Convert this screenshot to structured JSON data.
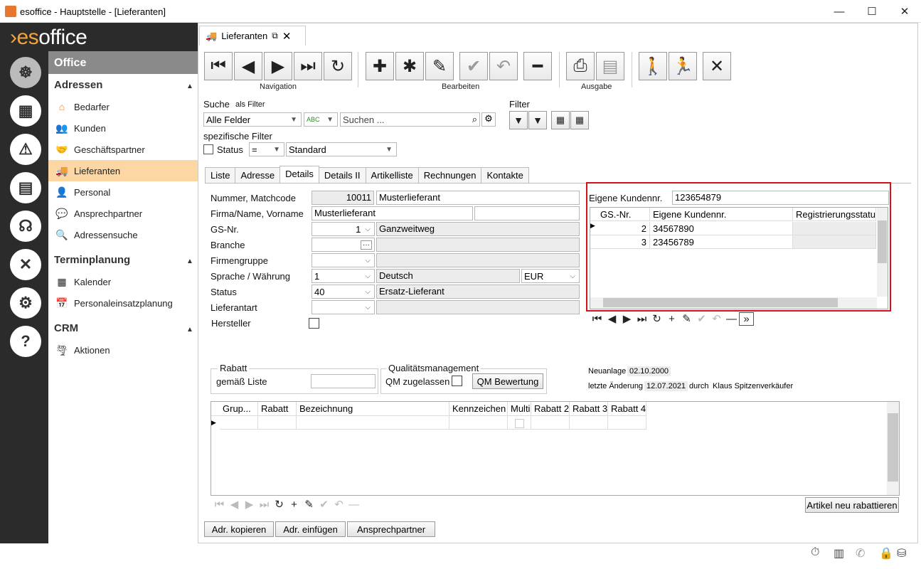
{
  "window": {
    "title": "esoffice - Hauptstelle - [Lieferanten]",
    "minimize": "—",
    "maximize": "☐",
    "close": "✕"
  },
  "logo": {
    "prefix": "›",
    "brand": "es",
    "rest": "office"
  },
  "sidebar": {
    "header": "Office",
    "sections": [
      {
        "title": "Adressen",
        "items": [
          "Bedarfer",
          "Kunden",
          "Geschäftspartner",
          "Lieferanten",
          "Personal",
          "Ansprechpartner",
          "Adressensuche"
        ]
      },
      {
        "title": "Terminplanung",
        "items": [
          "Kalender",
          "Personaleinsatzplanung"
        ]
      },
      {
        "title": "CRM",
        "items": [
          "Aktionen"
        ]
      }
    ],
    "selected": "Lieferanten"
  },
  "doc_tab": {
    "label": "Lieferanten"
  },
  "toolbar": {
    "groups": [
      "Navigation",
      "Bearbeiten",
      "Ausgabe"
    ]
  },
  "search": {
    "label": "Suche",
    "as_filter": "als Filter",
    "field": "Alle Felder",
    "placeholder": "Suchen ...",
    "specific": "spezifische Filter",
    "status_label": "Status",
    "operator": "=",
    "status_value": "Standard"
  },
  "filter": {
    "label": "Filter"
  },
  "tabs": [
    "Liste",
    "Adresse",
    "Details",
    "Details II",
    "Artikelliste",
    "Rechnungen",
    "Kontakte"
  ],
  "form": {
    "nummer_label": "Nummer, Matchcode",
    "nummer": "10011",
    "matchcode": "Musterlieferant",
    "firma_label": "Firma/Name, Vorname",
    "firma": "Musterlieferant",
    "vorname": "",
    "gs_label": "GS-Nr.",
    "gs": "1",
    "gs_name": "Ganzweitweg",
    "branche_label": "Branche",
    "branche": "",
    "firmengruppe_label": "Firmengruppe",
    "sprache_label": "Sprache / Währung",
    "sprache": "1",
    "sprache_name": "Deutsch",
    "waehrung": "EUR",
    "status_label": "Status",
    "status": "40",
    "status_name": "Ersatz-Lieferant",
    "lieferantart_label": "Lieferantart",
    "hersteller_label": "Hersteller"
  },
  "kundennr": {
    "label": "Eigene Kundennr.",
    "value": "123654879",
    "columns": [
      "GS.-Nr.",
      "Eigene Kundennr.",
      "Registrierungsstatus"
    ],
    "rows": [
      [
        "2",
        "34567890",
        ""
      ],
      [
        "3",
        "23456789",
        ""
      ]
    ]
  },
  "rabatt": {
    "legend": "Rabatt",
    "liste_label": "gemäß Liste",
    "liste": ""
  },
  "qm": {
    "legend": "Qualitätsmanagement",
    "zugelassen": "QM zugelassen",
    "bewertung": "QM Bewertung"
  },
  "meta": {
    "neuanlage_label": "Neuanlage",
    "neuanlage": "02.10.2000",
    "aenderung_label": "letzte Änderung",
    "aenderung": "12.07.2021",
    "durch": "durch",
    "user": "Klaus Spitzenverkäufer"
  },
  "rabatt_grid": {
    "columns": [
      "Grup...",
      "Rabatt",
      "Bezeichnung",
      "Kennzeichen",
      "Multi",
      "Rabatt 2",
      "Rabatt 3",
      "Rabatt 4"
    ]
  },
  "buttons": {
    "neu_rabattieren": "Artikel neu rabattieren",
    "kopieren": "Adr. kopieren",
    "einfuegen": "Adr. einfügen",
    "ansprechpartner": "Ansprechpartner"
  },
  "colors": {
    "accent": "#f2a33a",
    "highlight": "#d0141a",
    "selected": "#fcd7a4"
  }
}
